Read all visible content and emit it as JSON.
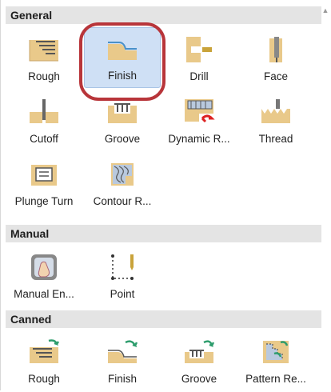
{
  "sections": {
    "general": {
      "title": "General"
    },
    "manual": {
      "title": "Manual"
    },
    "canned": {
      "title": "Canned"
    }
  },
  "general_tiles": {
    "rough": "Rough",
    "finish": "Finish",
    "drill": "Drill",
    "face": "Face",
    "cutoff": "Cutoff",
    "groove": "Groove",
    "dynamic_rough": "Dynamic R...",
    "thread": "Thread",
    "plunge_turn": "Plunge Turn",
    "contour_rough": "Contour R..."
  },
  "manual_tiles": {
    "manual_entry": "Manual En...",
    "point": "Point"
  },
  "canned_tiles": {
    "rough": "Rough",
    "finish": "Finish",
    "groove": "Groove",
    "pattern_repeat": "Pattern Re..."
  },
  "colors": {
    "stock": "#e9c98a",
    "selected_bg": "#cfe0f5",
    "highlight_ring": "#b8353a",
    "arrow_green": "#2e9d6d",
    "tool_gold": "#c9a33a"
  },
  "selected_tile": "Finish"
}
